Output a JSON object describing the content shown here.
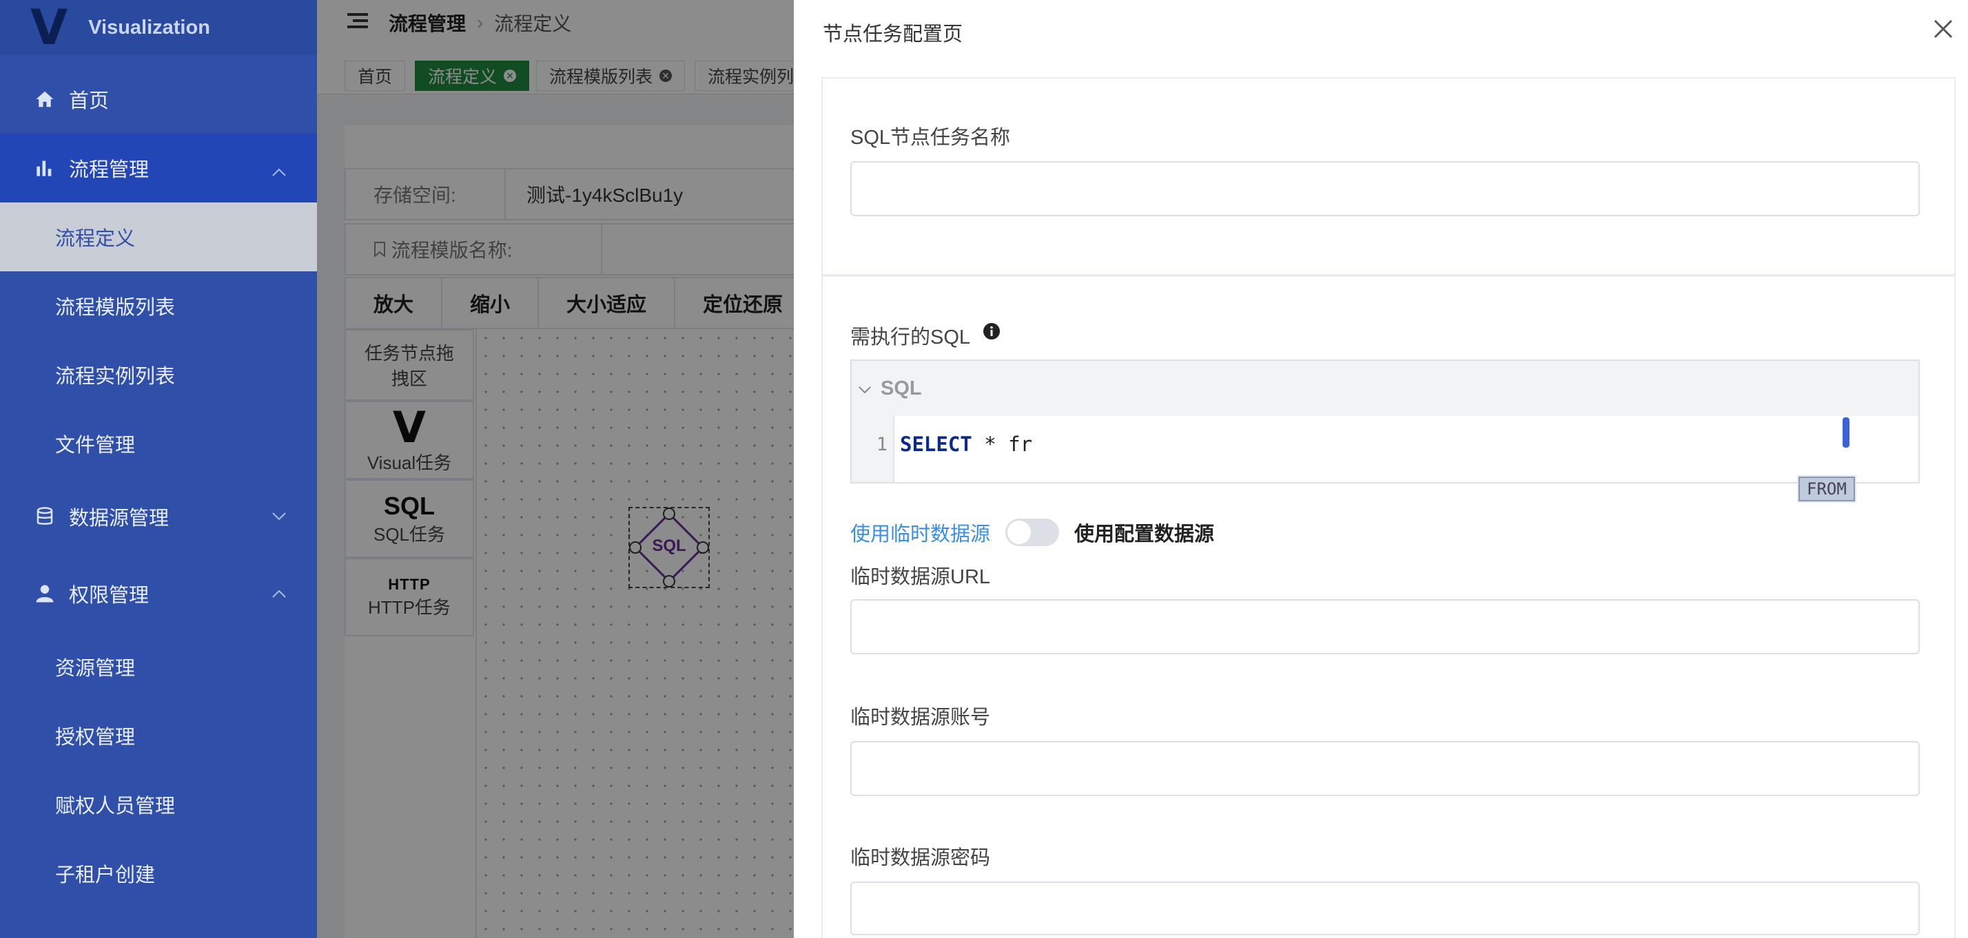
{
  "sidebar": {
    "logo_letter": "V",
    "logo_text": "Visualization",
    "items": [
      {
        "label": "首页"
      },
      {
        "label": "流程管理"
      },
      {
        "label": "流程定义"
      },
      {
        "label": "流程模版列表"
      },
      {
        "label": "流程实例列表"
      },
      {
        "label": "文件管理"
      },
      {
        "label": "数据源管理"
      },
      {
        "label": "权限管理"
      },
      {
        "label": "资源管理"
      },
      {
        "label": "授权管理"
      },
      {
        "label": "赋权人员管理"
      },
      {
        "label": "子租户创建"
      }
    ]
  },
  "header": {
    "breadcrumb": [
      "流程管理",
      "流程定义"
    ]
  },
  "tabs": [
    "首页",
    "流程定义",
    "流程模版列表",
    "流程实例列"
  ],
  "main": {
    "storage_label": "存储空间:",
    "storage_value": "测试-1y4kSclBu1y",
    "template_name_label": "流程模版名称:",
    "toolbar": [
      "放大",
      "缩小",
      "大小适应",
      "定位还原"
    ],
    "palette": [
      {
        "label": "任务节点拖拽区"
      },
      {
        "icon_text": "V",
        "label": "Visual任务"
      },
      {
        "icon_text": "SQL",
        "label": "SQL任务"
      },
      {
        "icon_text": "HTTP",
        "label": "HTTP任务"
      }
    ],
    "canvas_node_label": "SQL"
  },
  "drawer": {
    "title": "节点任务配置页",
    "task_name_label": "SQL节点任务名称",
    "task_name_value": "",
    "sql_label": "需执行的SQL",
    "editor_title": "SQL",
    "editor_line_number": "1",
    "editor_code_keyword": "SELECT",
    "editor_code_rest": " * fr",
    "autocomplete_hint": "FROM",
    "toggle_left_label": "使用临时数据源",
    "toggle_right_label": "使用配置数据源",
    "toggle_on": false,
    "url_label": "临时数据源URL",
    "url_value": "",
    "account_label": "临时数据源账号",
    "account_value": "",
    "password_label": "临时数据源密码",
    "password_value": ""
  },
  "colors": {
    "sidebar_bg": "#2f4fa8",
    "active_tab": "#1f8a3f",
    "link_blue": "#3a8ee6",
    "node_purple": "#6a2c9a"
  }
}
